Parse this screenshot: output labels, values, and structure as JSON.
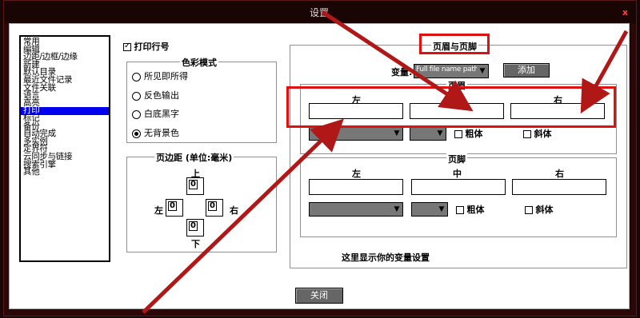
{
  "window": {
    "title": "设置",
    "close_glyph": "x"
  },
  "category_list": [
    "常用",
    "编辑",
    "边距/边框/边缘",
    "新建",
    "默认目录",
    "最近文件记录",
    "文件关联",
    "语言",
    "高亮",
    "打印",
    "标记",
    "备份",
    "自动完成",
    "多实例",
    "定界符",
    "云同步与链接",
    "搜索引擎",
    "其他"
  ],
  "selected_category": "打印",
  "print_line_numbers": {
    "label": "打印行号",
    "checked": true
  },
  "color_mode": {
    "title": "色彩模式",
    "options": [
      "所见即所得",
      "反色输出",
      "白底黑字",
      "无背景色"
    ],
    "selected": "无背景色"
  },
  "margins": {
    "title": "页边距 (单位:毫米)",
    "top_label": "上",
    "bottom_label": "下",
    "left_label": "左",
    "right_label": "右",
    "top_value": "0",
    "bottom_value": "0",
    "left_value": "0",
    "right_value": "0"
  },
  "header_footer": {
    "title": "页眉与页脚",
    "var_label": "变量:",
    "var_value": "Full file name path",
    "add_button": "添加",
    "header": {
      "title": "页眉",
      "left_label": "左",
      "center_label": "中",
      "right_label": "右",
      "bold_label": "粗体",
      "italic_label": "斜体"
    },
    "footer": {
      "title": "页脚",
      "left_label": "左",
      "center_label": "中",
      "right_label": "右",
      "bold_label": "粗体",
      "italic_label": "斜体"
    },
    "preview_text": "这里显示你的变量设置"
  },
  "close_button": "关闭",
  "colors": {
    "highlight_red": "#e01010",
    "selection_blue": "#0000ee",
    "arrow_red": "#b01818"
  }
}
